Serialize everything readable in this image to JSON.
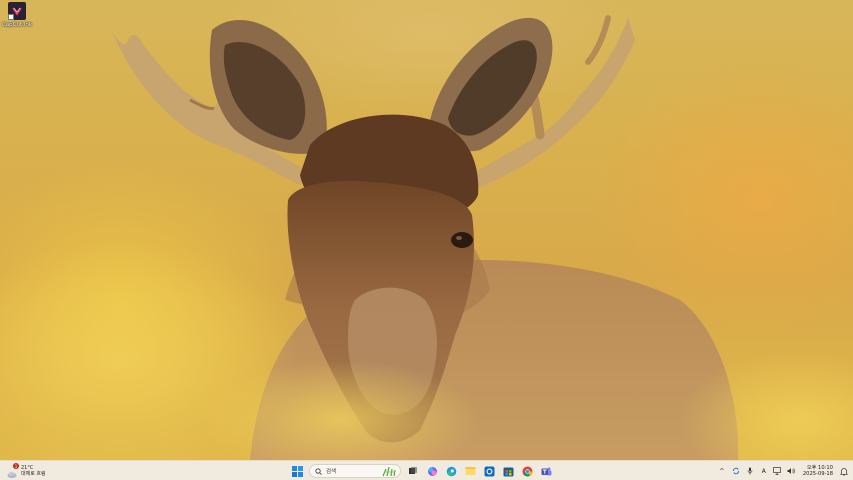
{
  "desktop": {
    "icons": [
      {
        "label": "CapCut.lnk",
        "icon": "app-shortcut-icon"
      }
    ]
  },
  "taskbar": {
    "weather": {
      "temperature": "21°C",
      "condition": "대체로 흐림",
      "badge": "1"
    },
    "search": {
      "placeholder": "검색"
    },
    "apps": [
      "task-view-icon",
      "copilot-icon",
      "edge-icon",
      "file-explorer-icon",
      "outlook-icon",
      "store-icon",
      "chrome-icon",
      "teams-icon"
    ],
    "tray": {
      "chevron": "^",
      "ime": "A",
      "time": "오후 10:10",
      "date": "2025-09-18"
    }
  },
  "colors": {
    "taskbar_bg": "#f1eadf",
    "accent": "#0078d4"
  }
}
